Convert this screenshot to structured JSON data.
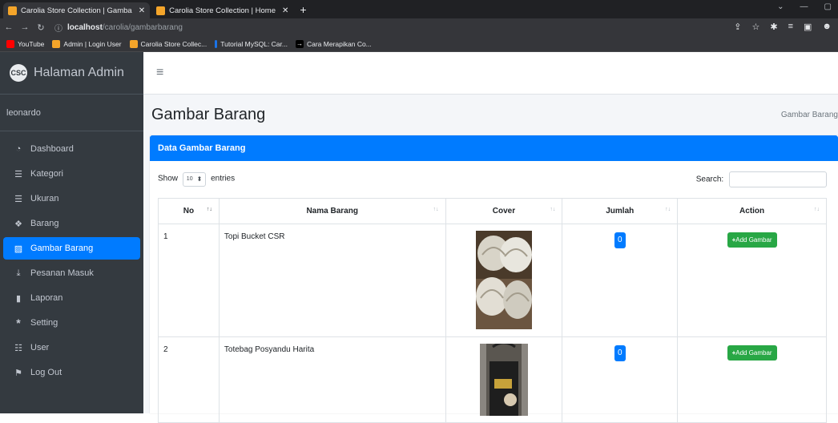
{
  "browser": {
    "tabs": [
      {
        "title": "Carolia Store Collection | Gamba",
        "active": true
      },
      {
        "title": "Carolia Store Collection | Home",
        "active": false
      }
    ],
    "url_host": "localhost",
    "url_path": "/carolia/gambarbarang",
    "bookmarks": [
      "YouTube",
      "Admin | Login User",
      "Carolia Store Collec...",
      "Tutorial MySQL: Car...",
      "Cara Merapikan Co..."
    ]
  },
  "brand": {
    "logo": "CSC",
    "title": "Halaman Admin"
  },
  "user": {
    "name": "leonardo"
  },
  "sidebar": {
    "items": [
      {
        "label": "Dashboard",
        "icon": "dashboard-icon"
      },
      {
        "label": "Kategori",
        "icon": "list-icon"
      },
      {
        "label": "Ukuran",
        "icon": "list-icon"
      },
      {
        "label": "Barang",
        "icon": "cubes-icon"
      },
      {
        "label": "Gambar Barang",
        "icon": "image-icon",
        "active": true
      },
      {
        "label": "Pesanan Masuk",
        "icon": "download-icon"
      },
      {
        "label": "Laporan",
        "icon": "file-icon"
      },
      {
        "label": "Setting",
        "icon": "asterisk-icon"
      },
      {
        "label": "User",
        "icon": "users-icon"
      },
      {
        "label": "Log Out",
        "icon": "flag-icon"
      }
    ]
  },
  "page": {
    "title": "Gambar Barang",
    "breadcrumb": "Gambar Barang"
  },
  "card": {
    "title": "Data Gambar Barang"
  },
  "table_controls": {
    "show_label": "Show",
    "entries_value": "10",
    "entries_label": "entries",
    "search_label": "Search:"
  },
  "table": {
    "headers": [
      "No",
      "Nama Barang",
      "Cover",
      "Jumlah",
      "Action"
    ],
    "rows": [
      {
        "no": "1",
        "name": "Topi Bucket CSR",
        "jumlah": "0",
        "action": "Add Gambar"
      },
      {
        "no": "2",
        "name": "Totebag Posyandu Harita",
        "jumlah": "0",
        "action": "Add Gambar"
      }
    ]
  }
}
